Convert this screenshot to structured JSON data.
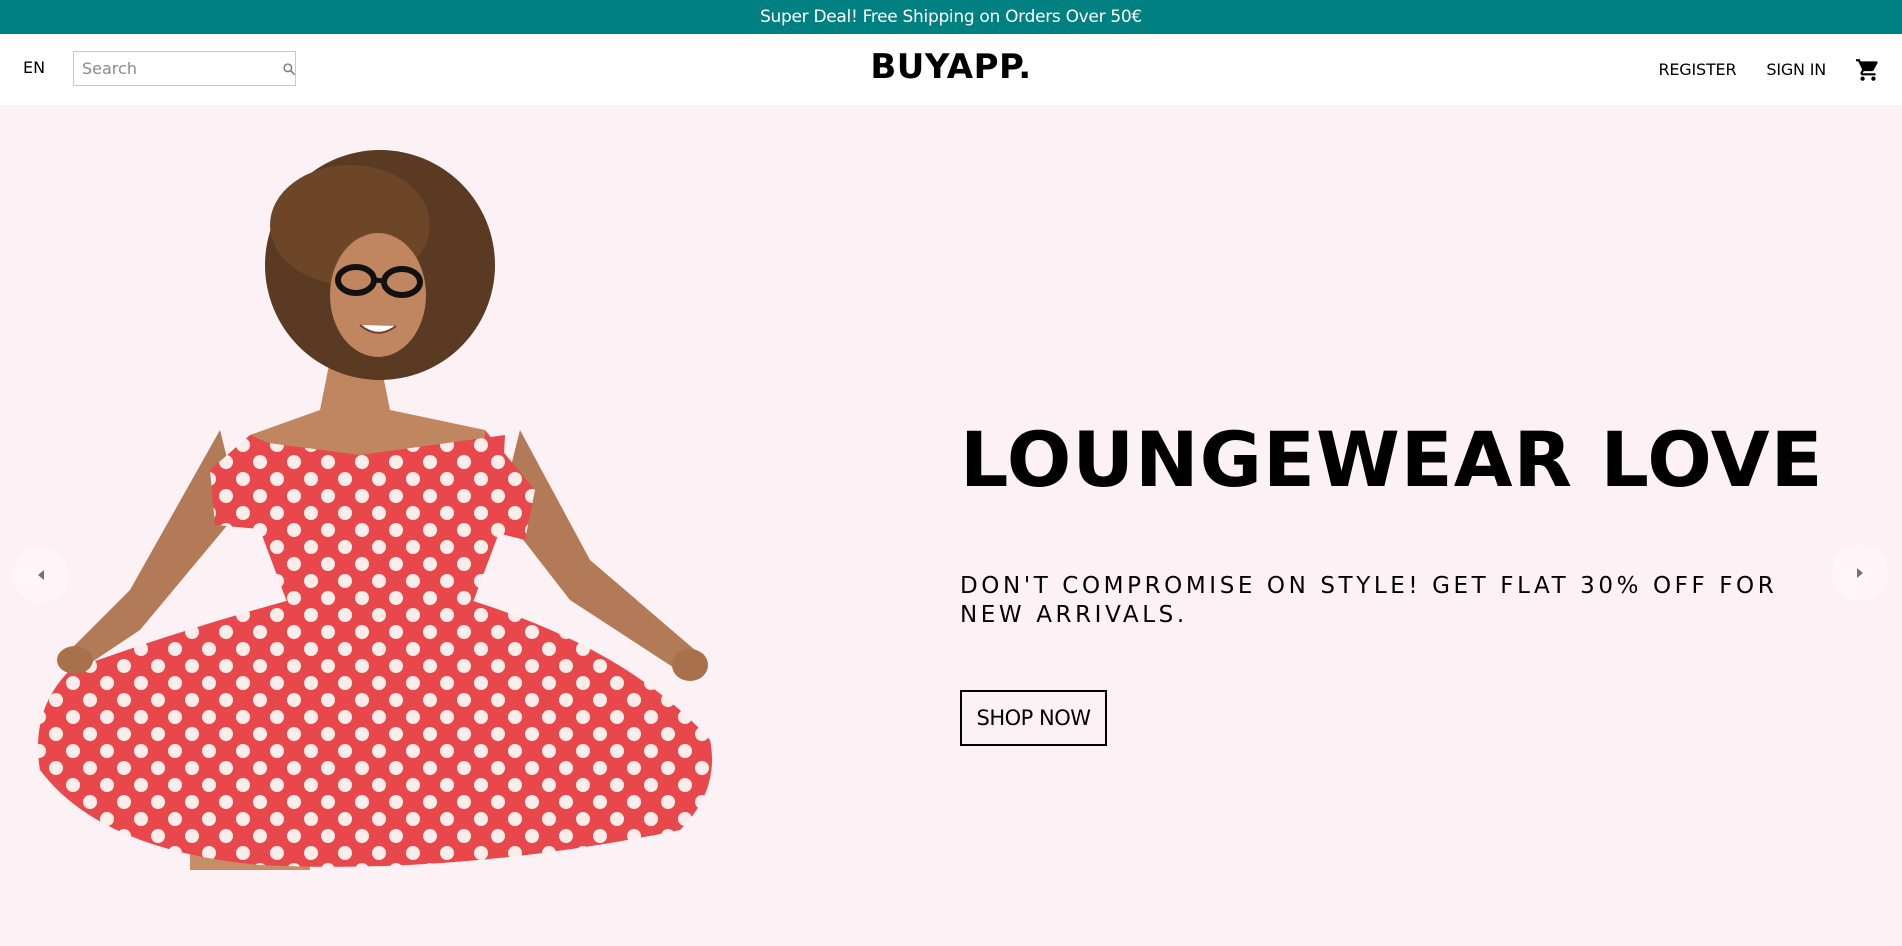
{
  "announcement": {
    "text": "Super Deal! Free Shipping on Orders Over 50€"
  },
  "navbar": {
    "language": "EN",
    "search": {
      "placeholder": "Search",
      "value": "",
      "icon": "search-icon"
    },
    "logo": "BUYAPP.",
    "register_label": "REGISTER",
    "signin_label": "SIGN IN",
    "cart_icon": "cart-icon"
  },
  "slider": {
    "title": "LOUNGEWEAR LOVE",
    "description": "DON'T COMPROMISE ON STYLE! GET FLAT 30% OFF FOR NEW ARRIVALS.",
    "button_label": "SHOP NOW",
    "prev_icon": "arrow-left-icon",
    "next_icon": "arrow-right-icon"
  },
  "colors": {
    "announcement_bg": "#008080",
    "hero_bg": "#fcf1f5",
    "dress_red": "#e8474c"
  }
}
